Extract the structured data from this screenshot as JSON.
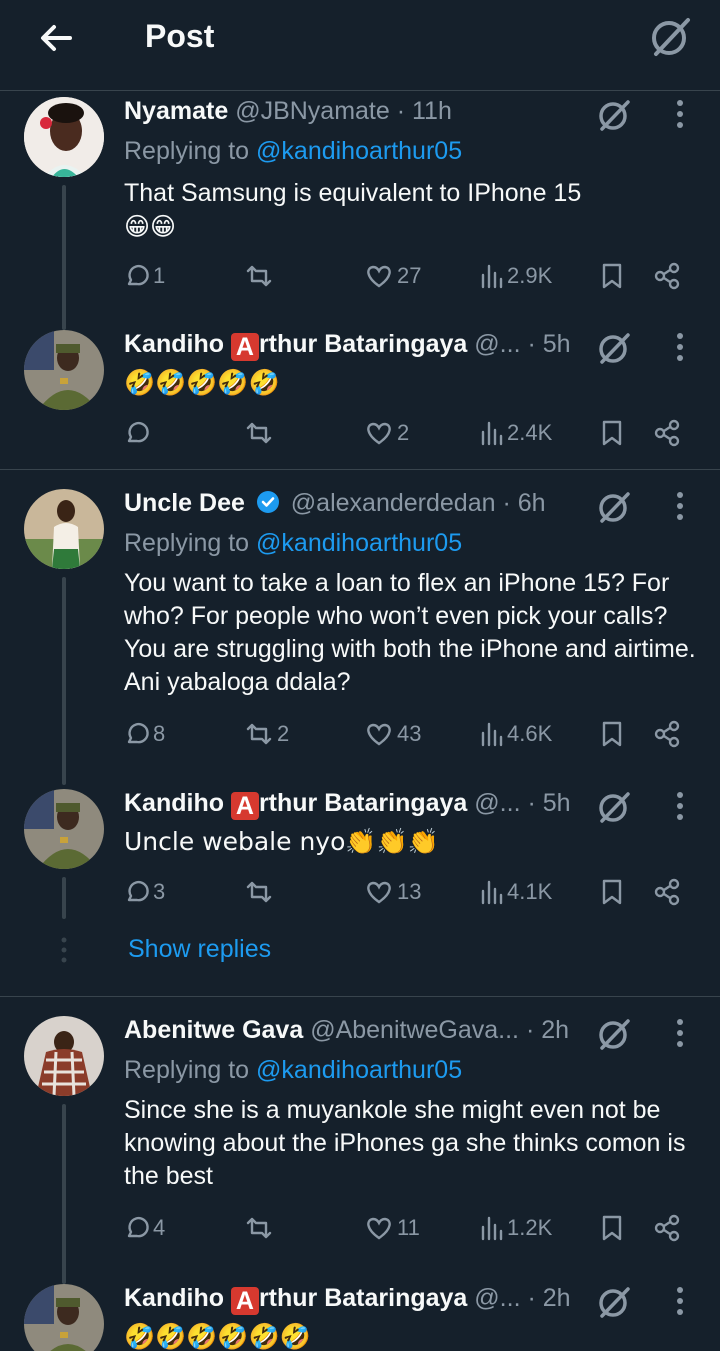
{
  "header": {
    "title": "Post"
  },
  "colors": {
    "background": "#15202b",
    "accent": "#1d9bf0",
    "muted": "#8b98a5",
    "border": "#38444d"
  },
  "tweets": [
    {
      "name": "Nyamate",
      "handle": "@JBNyamate",
      "time": "· 11h",
      "replying_prefix": "Replying to",
      "replying_to": "@kandihoarthur05",
      "text": "That Samsung is equivalent to IPhone 15",
      "text2": "😁😁",
      "replies": "1",
      "retweets": "",
      "likes": "27",
      "views": "2.9K"
    },
    {
      "name_prefix": "Kandiho",
      "name_badge": "A",
      "name_suffix": "rthur Bataringaya",
      "handle": "@...",
      "time": "· 5h",
      "text": "🤣🤣🤣🤣🤣",
      "replies": "",
      "retweets": "",
      "likes": "2",
      "views": "2.4K"
    },
    {
      "name": "Uncle Dee",
      "handle": "@alexanderdedan",
      "time": "· 6h",
      "replying_prefix": "Replying to",
      "replying_to": "@kandihoarthur05",
      "text": "You want to take a loan to flex an iPhone 15? For who? For people who won’t even pick your calls? You are struggling with both the iPhone and airtime. Ani yabaloga ddala?",
      "replies": "8",
      "retweets": "2",
      "likes": "43",
      "views": "4.6K"
    },
    {
      "name_prefix": "Kandiho",
      "name_badge": "A",
      "name_suffix": "rthur Bataringaya",
      "handle": "@...",
      "time": "· 5h",
      "text": "Uncle webale nyo👏👏👏",
      "replies": "3",
      "retweets": "",
      "likes": "13",
      "views": "4.1K"
    },
    {
      "name": "Abenitwe Gava",
      "handle": "@AbenitweGava...",
      "time": "· 2h",
      "replying_prefix": "Replying to",
      "replying_to": "@kandihoarthur05",
      "text": "Since she is a muyankole she might even not be knowing about the iPhones ga she thinks comon is the best",
      "replies": "4",
      "retweets": "",
      "likes": "11",
      "views": "1.2K"
    },
    {
      "name_prefix": "Kandiho",
      "name_badge": "A",
      "name_suffix": "rthur Bataringaya",
      "handle": "@...",
      "time": "· 2h",
      "text": "🤣🤣🤣🤣🤣🤣"
    }
  ],
  "show_replies": "Show replies",
  "icons": [
    "back-arrow-icon",
    "grok-icon",
    "more-icon",
    "reply-icon",
    "retweet-icon",
    "like-icon",
    "views-icon",
    "bookmark-icon",
    "share-icon",
    "verified-icon"
  ]
}
